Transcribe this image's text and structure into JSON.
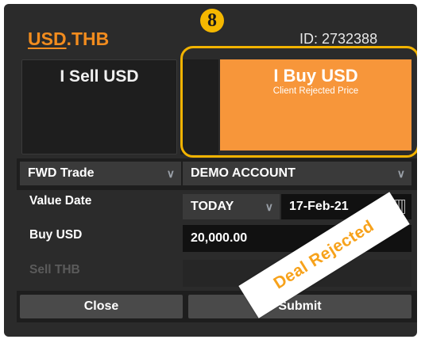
{
  "header": {
    "pair_base": "USD",
    "pair_dot": ".",
    "pair_quote": "THB",
    "ticket_id": "ID: 2732388",
    "step_badge": "8"
  },
  "trade_buttons": {
    "sell_label": "I Sell USD",
    "buy_label": "I Buy USD",
    "buy_status": "Client Rejected Price"
  },
  "form": {
    "trade_type": "FWD Trade",
    "account": "DEMO ACCOUNT",
    "value_date_label": "Value Date",
    "tenor": "TODAY",
    "date": "17-Feb-21",
    "buy_label": "Buy USD",
    "buy_amount": "20,000.00",
    "sell_label": "Sell THB",
    "sell_amount": ""
  },
  "actions": {
    "close_label": "Close",
    "submit_label": "Submit"
  },
  "overlay": {
    "stamp_text": "Deal Rejected"
  },
  "colors": {
    "accent": "#f28c1e",
    "buy_fill": "#f7963a",
    "highlight": "#f2b300",
    "panel": "#2b2b2b"
  },
  "icons": {
    "dropdown": "chevron-down-icon",
    "calendar": "calendar-icon"
  }
}
